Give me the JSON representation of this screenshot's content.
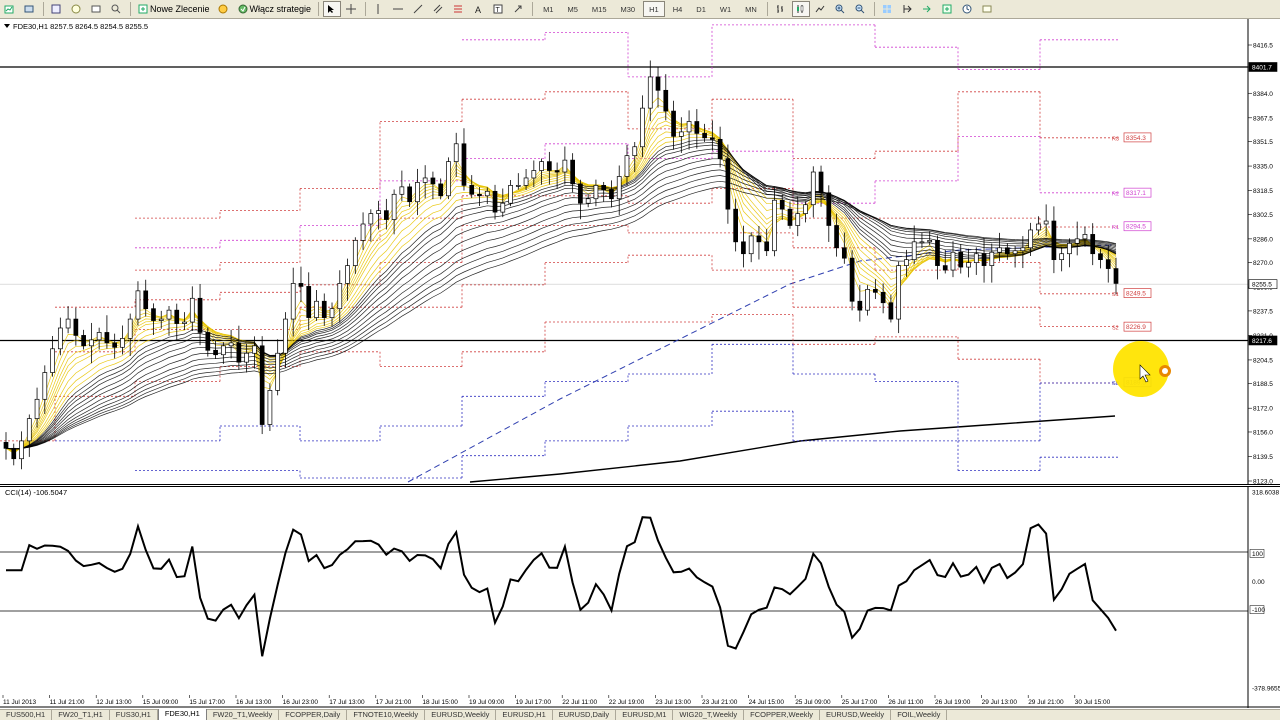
{
  "toolbar": {
    "new_order_label": "Nowe Zlecenie",
    "strategy_label": "Włącz strategie",
    "timeframes": [
      "M1",
      "M5",
      "M15",
      "M30",
      "H1",
      "H4",
      "D1",
      "W1",
      "MN"
    ],
    "active_timeframe": "H1"
  },
  "chart": {
    "header": "FDE30,H1  8257.5 8264.5 8254.5 8255.5",
    "price_axis": [
      "8416.5",
      "8401.7",
      "8384.0",
      "8367.5",
      "8351.5",
      "8335.0",
      "8318.5",
      "8302.5",
      "8286.0",
      "8270.0",
      "8253.5",
      "8237.5",
      "8221.0",
      "8204.5",
      "8188.5",
      "8172.0",
      "8156.0",
      "8139.5",
      "8123.0"
    ],
    "current_price": "8255.5",
    "hline_upper": "8401.7",
    "hline_lower": "8217.6",
    "pivot_labels": [
      {
        "level": "8354.3",
        "tag": "R3"
      },
      {
        "level": "8317.1",
        "tag": "R2"
      },
      {
        "level": "8294.5",
        "tag": "R1"
      },
      {
        "level": "8249.5",
        "tag": "S1"
      },
      {
        "level": "8226.9",
        "tag": "S2"
      },
      {
        "level": "8189.5",
        "tag": "S3"
      }
    ],
    "time_axis": [
      "11 Jul 2013",
      "11 Jul 21:00",
      "12 Jul 13:00",
      "15 Jul 09:00",
      "15 Jul 17:00",
      "16 Jul 13:00",
      "16 Jul 23:00",
      "17 Jul 13:00",
      "17 Jul 21:00",
      "18 Jul 15:00",
      "19 Jul 09:00",
      "19 Jul 17:00",
      "22 Jul 11:00",
      "22 Jul 19:00",
      "23 Jul 13:00",
      "23 Jul 21:00",
      "24 Jul 15:00",
      "25 Jul 09:00",
      "25 Jul 17:00",
      "26 Jul 11:00",
      "26 Jul 19:00",
      "29 Jul 13:00",
      "29 Jul 21:00",
      "30 Jul 15:00"
    ]
  },
  "cci": {
    "header": "CCI(14) -106.5047",
    "axis": [
      "318.6038",
      "100",
      "0.00",
      "-100",
      "-378.9655"
    ]
  },
  "tabs": [
    "FUS500,H1",
    "FW20_T1,H1",
    "FUS30,H1",
    "FDE30,H1",
    "FW20_T1,Weekly",
    "FCOPPER,Daily",
    "FTNOTE10,Weekly",
    "EURUSD,Weekly",
    "EURUSD,H1",
    "EURUSD,Daily",
    "EURUSD,M1",
    "WIG20_T,Weekly",
    "FCOPPER,Weekly",
    "EURUSD,Weekly",
    "FOIL,Weekly"
  ],
  "active_tab": "FDE30,H1",
  "colors": {
    "ribbon_fast": "#e8c400",
    "ribbon_slow": "#000000",
    "pivot_red": "#d04040",
    "pivot_magenta": "#d040d0",
    "pivot_blue": "#3030c0",
    "cursor_highlight": "#ffe000"
  },
  "series": {
    "closes": [
      8145,
      8138,
      8150,
      8165,
      8178,
      8196,
      8212,
      8226,
      8232,
      8221,
      8214,
      8218,
      8223,
      8216,
      8213,
      8219,
      8232,
      8251,
      8239,
      8231,
      8232,
      8238,
      8229,
      8230,
      8246,
      8223,
      8211,
      8208,
      8214,
      8216,
      8203,
      8209,
      8214,
      8161,
      8184,
      8209,
      8232,
      8256,
      8254,
      8233,
      8244,
      8233,
      8239,
      8256,
      8268,
      8285,
      8296,
      8303,
      8305,
      8299,
      8316,
      8321,
      8311,
      8324,
      8327,
      8323,
      8315,
      8338,
      8350,
      8322,
      8316,
      8315,
      8318,
      8304,
      8310,
      8322,
      8322,
      8327,
      8332,
      8338,
      8332,
      8331,
      8339,
      8323,
      8310,
      8313,
      8322,
      8319,
      8313,
      8328,
      8342,
      8348,
      8374,
      8395,
      8386,
      8372,
      8355,
      8358,
      8365,
      8357,
      8354,
      8353,
      8340,
      8306,
      8284,
      8276,
      8288,
      8284,
      8278,
      8312,
      8306,
      8295,
      8303,
      8309,
      8331,
      8317,
      8295,
      8280,
      8273,
      8244,
      8238,
      8252,
      8250,
      8243,
      8232,
      8268,
      8272,
      8284,
      8284,
      8285,
      8268,
      8265,
      8277,
      8267,
      8270,
      8276,
      8268,
      8277,
      8280,
      8276,
      8278,
      8280,
      8292,
      8296,
      8298,
      8272,
      8276,
      8283,
      8286,
      8289,
      8276,
      8272,
      8266,
      8256
    ]
  }
}
